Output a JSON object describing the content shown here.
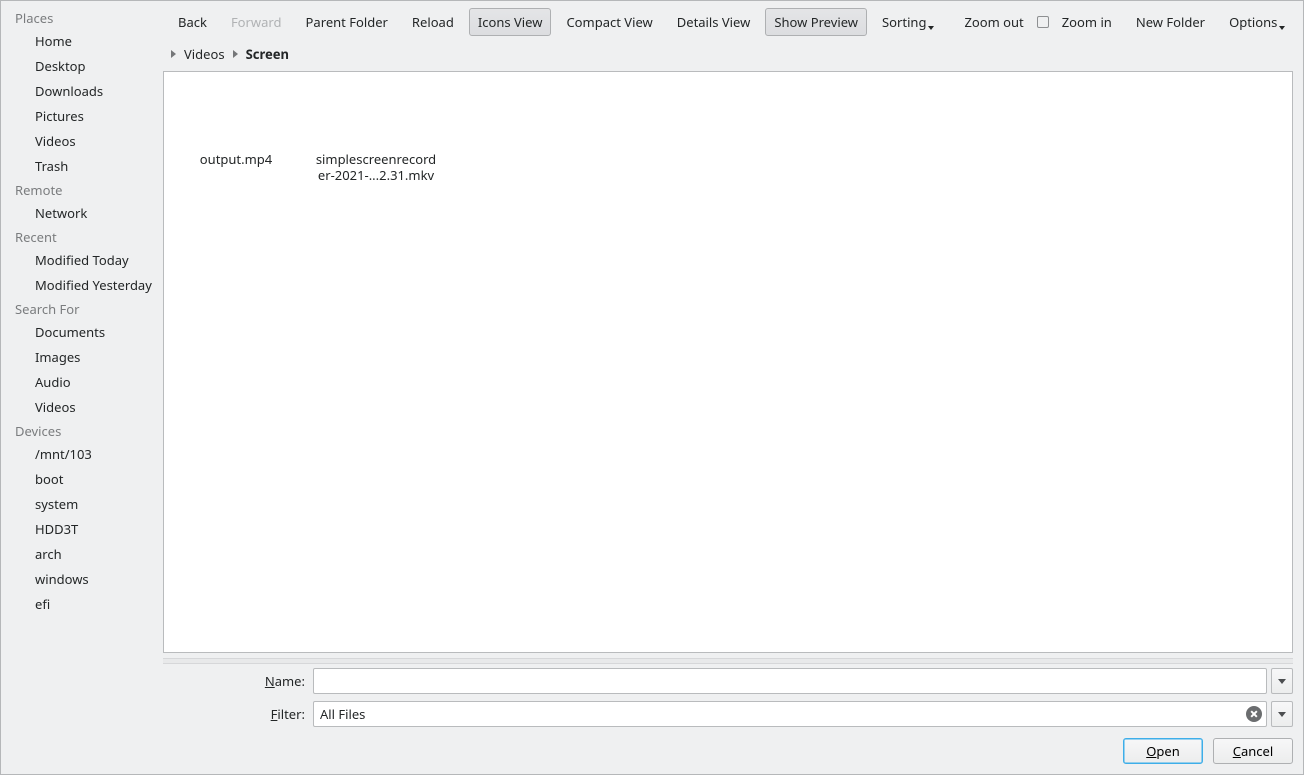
{
  "sidebar": {
    "sections": [
      {
        "header": "Places",
        "items": [
          "Home",
          "Desktop",
          "Downloads",
          "Pictures",
          "Videos",
          "Trash"
        ]
      },
      {
        "header": "Remote",
        "items": [
          "Network"
        ]
      },
      {
        "header": "Recent",
        "items": [
          "Modified Today",
          "Modified Yesterday"
        ]
      },
      {
        "header": "Search For",
        "items": [
          "Documents",
          "Images",
          "Audio",
          "Videos"
        ]
      },
      {
        "header": "Devices",
        "items": [
          "/mnt/103",
          "boot",
          "system",
          "HDD3T",
          "arch",
          "windows",
          "efi"
        ]
      }
    ]
  },
  "toolbar": {
    "back": "Back",
    "forward": "Forward",
    "parent": "Parent Folder",
    "reload": "Reload",
    "icons_view": "Icons View",
    "compact_view": "Compact View",
    "details_view": "Details View",
    "show_preview": "Show Preview",
    "sorting": "Sorting",
    "zoom_out": "Zoom out",
    "zoom_in": "Zoom in",
    "new_folder": "New Folder",
    "options": "Options"
  },
  "breadcrumb": {
    "items": [
      {
        "label": "Videos",
        "current": false
      },
      {
        "label": "Screen",
        "current": true
      }
    ]
  },
  "files": [
    {
      "name": "output.mp4"
    },
    {
      "name": "simplescreenrecorder-2021-...2.31.mkv"
    }
  ],
  "form": {
    "name_label_pre": "N",
    "name_label_post": "ame:",
    "name_value": "",
    "filter_label_pre": "F",
    "filter_label_post": "ilter:",
    "filter_value": "All Files"
  },
  "buttons": {
    "open_pre": "O",
    "open_post": "pen",
    "cancel_pre": "C",
    "cancel_post": "ancel"
  }
}
